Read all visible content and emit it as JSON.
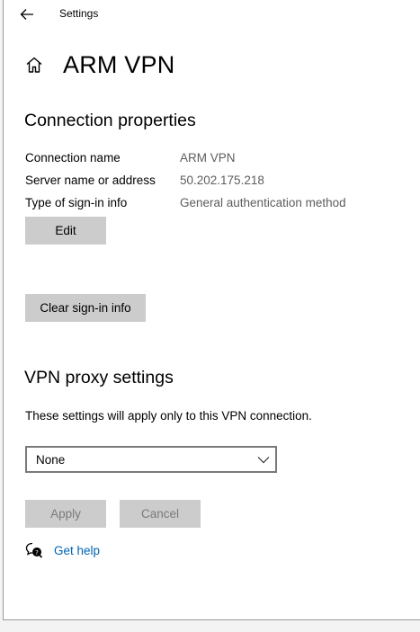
{
  "window": {
    "title": "Settings"
  },
  "page": {
    "title": "ARM VPN"
  },
  "connection": {
    "heading": "Connection properties",
    "rows": [
      {
        "label": "Connection name",
        "value": "ARM VPN"
      },
      {
        "label": "Server name or address",
        "value": "50.202.175.218"
      },
      {
        "label": "Type of sign-in info",
        "value": "General authentication method"
      }
    ],
    "edit_label": "Edit",
    "clear_label": "Clear sign-in info"
  },
  "proxy": {
    "heading": "VPN proxy settings",
    "description": "These settings will apply only to this VPN connection.",
    "selected": "None",
    "apply_label": "Apply",
    "cancel_label": "Cancel"
  },
  "help": {
    "label": "Get help"
  },
  "icons": {
    "back": "back-arrow-icon",
    "home": "home-icon",
    "chevron": "chevron-down-icon",
    "help": "help-chat-icon"
  },
  "colors": {
    "link": "#0063b1",
    "button": "#cccccc",
    "value_text": "#5d5d5d"
  }
}
